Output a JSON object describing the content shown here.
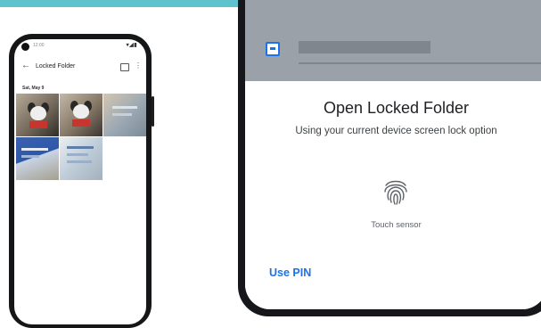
{
  "colors": {
    "top_band": "#5ec3cc",
    "accent": "#1a73e8",
    "scrim": "#9aa1a8"
  },
  "phone_left": {
    "status_bar": {
      "time": "12:00",
      "icons": "▾◢▮"
    },
    "app_bar": {
      "back_icon": "arrow-back-icon",
      "title": "Locked Folder",
      "actions": [
        "select-icon",
        "more-vert-icon"
      ]
    },
    "date_header": "Sat, May 9",
    "photos": [
      {
        "subject": "dog"
      },
      {
        "subject": "dog"
      },
      {
        "subject": "document"
      },
      {
        "subject": "credit card"
      },
      {
        "subject": "document"
      }
    ]
  },
  "phone_right": {
    "background_row_icon": "file-icon",
    "sheet": {
      "title": "Open Locked Folder",
      "subtitle": "Using your current device screen lock option",
      "sensor_icon": "fingerprint-icon",
      "sensor_label": "Touch sensor",
      "pin_button": "Use PIN"
    }
  }
}
